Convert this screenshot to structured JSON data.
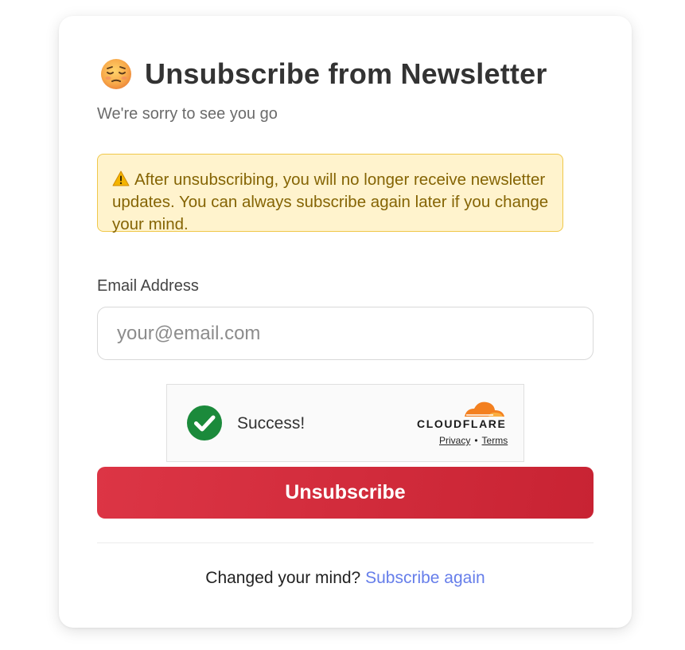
{
  "header": {
    "emoji_icon": "pensive-face-emoji",
    "title": "Unsubscribe from Newsletter",
    "subtitle": "We're sorry to see you go"
  },
  "warning": {
    "icon": "warning-icon",
    "text": "After unsubscribing, you will no longer receive newsletter updates. You can always subscribe again later if you change your mind.",
    "background": "#fff3cd",
    "border": "#f0c84a",
    "text_color": "#856404"
  },
  "form": {
    "email_label": "Email Address",
    "email_value": "",
    "email_placeholder": "your@email.com"
  },
  "captcha": {
    "status_icon": "check-circle-icon",
    "status_text": "Success!",
    "brand": "CLOUDFLARE",
    "privacy_link": "Privacy",
    "separator": "•",
    "terms_link": "Terms"
  },
  "actions": {
    "unsubscribe_label": "Unsubscribe",
    "button_color": "#dc3545"
  },
  "footer": {
    "prompt": "Changed your mind?",
    "link_label": "Subscribe again",
    "link_color": "#667eea"
  }
}
